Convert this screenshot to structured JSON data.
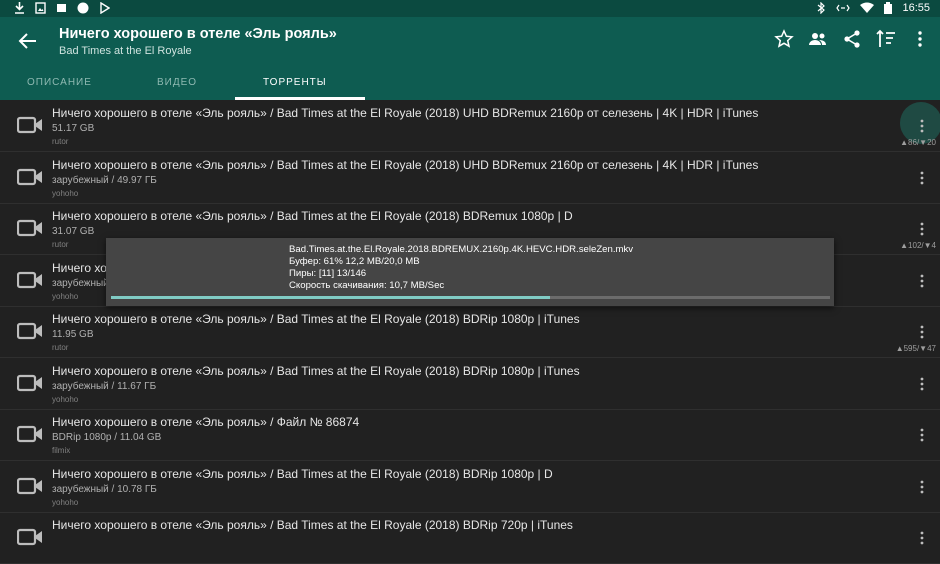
{
  "status_bar": {
    "time": "16:55",
    "left_icons": [
      "download-icon",
      "image-icon",
      "photo-icon",
      "circle-icon",
      "play-icon"
    ],
    "right_icons": [
      "bluetooth-icon",
      "sync-icon",
      "wifi-icon",
      "battery-icon"
    ]
  },
  "app_bar": {
    "title": "Ничего хорошего в отеле «Эль рояль»",
    "subtitle": "Bad Times at the El Royale",
    "actions": [
      "star-icon",
      "people-icon",
      "share-icon",
      "sort-icon",
      "more-icon"
    ]
  },
  "tabs": [
    {
      "label": "ОПИСАНИЕ",
      "active": false
    },
    {
      "label": "ВИДЕО",
      "active": false
    },
    {
      "label": "ТОРРЕНТЫ",
      "active": true
    }
  ],
  "torrents": [
    {
      "title": "Ничего хорошего в отеле «Эль рояль» / Bad Times at the El Royale (2018) UHD BDRemux 2160p от селезень | 4K | HDR | iTunes",
      "size": "51.17 GB",
      "source": "rutor",
      "peers": "▲86/▼20"
    },
    {
      "title": "Ничего хорошего в отеле «Эль рояль» / Bad Times at the El Royale (2018) UHD BDRemux 2160p от селезень | 4K | HDR | iTunes",
      "size": "зарубежный / 49.97 ГБ",
      "source": "yohoho",
      "peers": ""
    },
    {
      "title": "Ничего хорошего в отеле «Эль рояль» / Bad Times at the El Royale (2018) BDRemux 1080p | D",
      "size": "31.07 GB",
      "source": "rutor",
      "peers": "▲102/▼4"
    },
    {
      "title": "Ничего хорошего в отеле «Эль рояль» / Bad Times at the El Royale (2018) BDRemux 1080p | D",
      "size": "зарубежный / 31.07 ГБ",
      "source": "yohoho",
      "peers": ""
    },
    {
      "title": "Ничего хорошего в отеле «Эль рояль» / Bad Times at the El Royale (2018) BDRip 1080p | iTunes",
      "size": "11.95 GB",
      "source": "rutor",
      "peers": "▲595/▼47"
    },
    {
      "title": "Ничего хорошего в отеле «Эль рояль» / Bad Times at the El Royale (2018) BDRip 1080p | iTunes",
      "size": "зарубежный / 11.67 ГБ",
      "source": "yohoho",
      "peers": ""
    },
    {
      "title": "Ничего хорошего в отеле «Эль рояль» / Файл № 86874",
      "size": "BDRip 1080p / 11.04 GB",
      "source": "filmix",
      "peers": ""
    },
    {
      "title": "Ничего хорошего в отеле «Эль рояль» / Bad Times at the El Royale (2018) BDRip 1080p | D",
      "size": "зарубежный / 10.78 ГБ",
      "source": "yohoho",
      "peers": ""
    },
    {
      "title": "Ничего хорошего в отеле «Эль рояль» / Bad Times at the El Royale (2018) BDRip 720p | iTunes",
      "size": "",
      "source": "",
      "peers": ""
    }
  ],
  "dialog": {
    "filename": "Bad.Times.at.the.El.Royale.2018.BDREMUX.2160p.4K.HEVC.HDR.seleZen.mkv",
    "buffer": "Буфер: 61% 12,2 MB/20,0 MB",
    "peers": "Пиры: [11] 13/146",
    "speed": "Скорость скачивания: 10,7 MB/Sec",
    "progress": 0.61
  },
  "colors": {
    "accent": "#80cbc4",
    "appbar": "#0e5c51",
    "statusbar": "#0b4a40",
    "background": "#212121"
  }
}
